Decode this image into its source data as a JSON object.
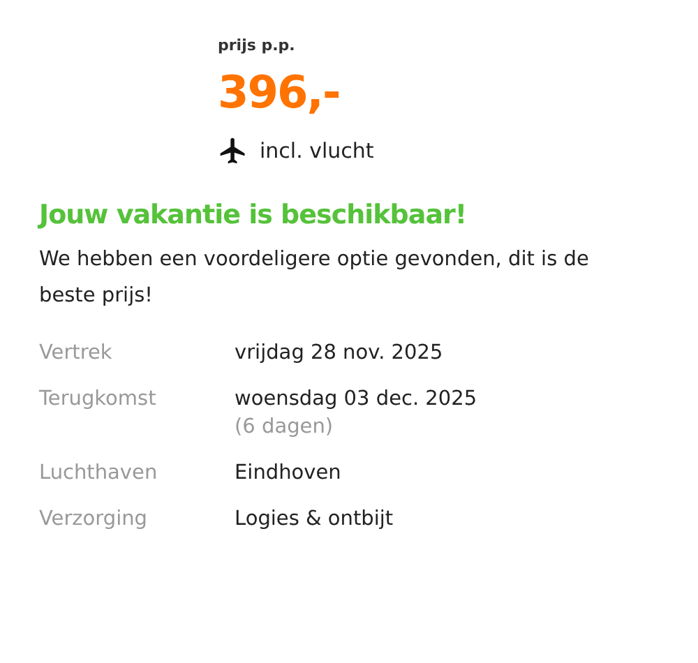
{
  "price": {
    "label": "prijs p.p.",
    "amount": "396,-",
    "flight": "incl. vlucht"
  },
  "availability": {
    "title": "Jouw vakantie is beschikbaar!",
    "message": "We hebben een voordeligere optie gevonden, dit is de beste prijs!"
  },
  "details": [
    {
      "label": "Vertrek",
      "value": "vrijdag 28 nov. 2025"
    },
    {
      "label": "Terugkomst",
      "value": "woensdag 03 dec. 2025",
      "note": "(6 dagen)"
    },
    {
      "label": "Luchthaven",
      "value": "Eindhoven"
    },
    {
      "label": "Verzorging",
      "value": "Logies & ontbijt"
    }
  ]
}
